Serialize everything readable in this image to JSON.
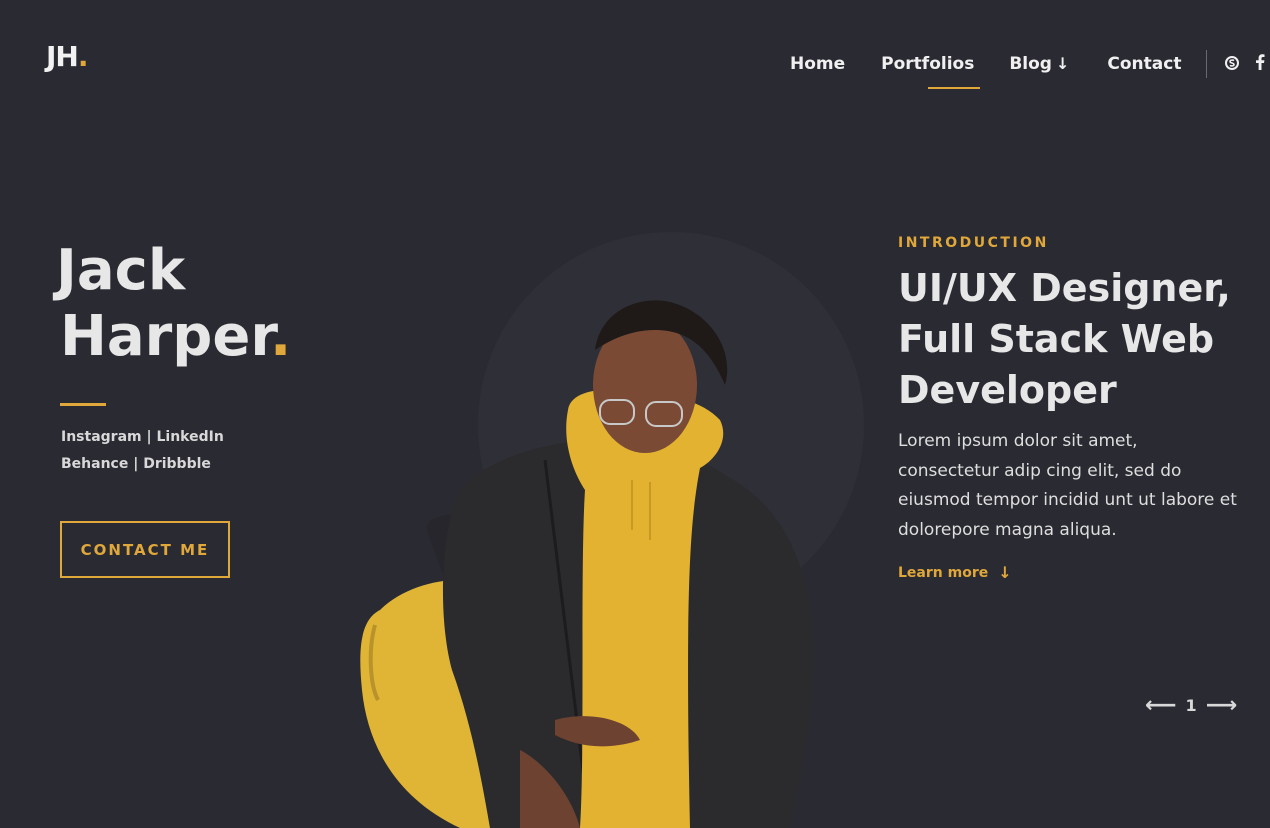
{
  "header": {
    "logo_text": "JH",
    "logo_dot": ".",
    "nav": [
      {
        "label": "Home"
      },
      {
        "label": "Portfolios"
      },
      {
        "label": "Blog",
        "arrow": "↓"
      },
      {
        "label": "Contact"
      }
    ],
    "active_nav": "Portfolios",
    "social_icons": [
      "skype-icon",
      "facebook-icon"
    ]
  },
  "hero": {
    "name_line1": "Jack",
    "name_line2": "Harper",
    "name_dot": ".",
    "social_links_line1": "Instagram | LinkedIn",
    "social_links_line2": "Behance | Dribbble",
    "cta_label": "CONTACT ME"
  },
  "intro": {
    "label": "INTRODUCTION",
    "headline_lines": [
      "UI/UX Designer,",
      "Full Stack Web",
      "Developer"
    ],
    "blurb_lines": [
      "Lorem ipsum dolor sit amet,",
      "consectetur adip cing elit, sed do",
      "eiusmod tempor incidid unt ut labore et",
      "dolorepore magna aliqua."
    ],
    "learn_more": "Learn more",
    "learn_more_arrow": "↓"
  },
  "pager": {
    "prev": "⟵",
    "current": "1",
    "next": "⟶"
  },
  "colors": {
    "background": "#2a2a32",
    "accent": "#e0a73a",
    "text": "#e7e7e7"
  }
}
